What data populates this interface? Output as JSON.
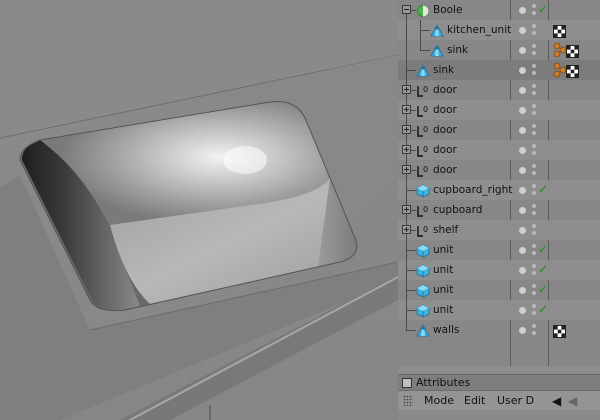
{
  "object_manager": {
    "rows": [
      {
        "name": "Boole",
        "level": 0,
        "expander": "minus",
        "icon": "boole-icon",
        "check": true,
        "tags": []
      },
      {
        "name": "kitchen_unit",
        "level": 1,
        "expander": "none",
        "icon": "cone-icon",
        "check": false,
        "tags": [
          "checker-tag-icon"
        ]
      },
      {
        "name": "sink",
        "level": 1,
        "expander": "none",
        "icon": "cone-icon",
        "check": false,
        "tags": [
          "phong-tag-icon",
          "checker-tag-icon"
        ]
      },
      {
        "name": "sink",
        "level": 0,
        "expander": "none",
        "icon": "cone-icon",
        "check": false,
        "tags": [
          "phong-tag-icon",
          "checker-tag-icon"
        ]
      },
      {
        "name": "door",
        "level": 0,
        "expander": "plus",
        "icon": "null-icon",
        "check": false,
        "tags": []
      },
      {
        "name": "door",
        "level": 0,
        "expander": "plus",
        "icon": "null-icon",
        "check": false,
        "tags": []
      },
      {
        "name": "door",
        "level": 0,
        "expander": "plus",
        "icon": "null-icon",
        "check": false,
        "tags": []
      },
      {
        "name": "door",
        "level": 0,
        "expander": "plus",
        "icon": "null-icon",
        "check": false,
        "tags": []
      },
      {
        "name": "door",
        "level": 0,
        "expander": "plus",
        "icon": "null-icon",
        "check": false,
        "tags": []
      },
      {
        "name": "cupboard_right",
        "level": 0,
        "expander": "none",
        "icon": "cube-icon",
        "check": true,
        "tags": []
      },
      {
        "name": "cupboard",
        "level": 0,
        "expander": "plus",
        "icon": "null-icon",
        "check": false,
        "tags": []
      },
      {
        "name": "shelf",
        "level": 0,
        "expander": "plus",
        "icon": "null-icon",
        "check": false,
        "tags": []
      },
      {
        "name": "unit",
        "level": 0,
        "expander": "none",
        "icon": "cube-icon",
        "check": true,
        "tags": []
      },
      {
        "name": "unit",
        "level": 0,
        "expander": "none",
        "icon": "cube-icon",
        "check": true,
        "tags": []
      },
      {
        "name": "unit",
        "level": 0,
        "expander": "none",
        "icon": "cube-icon",
        "check": true,
        "tags": []
      },
      {
        "name": "unit",
        "level": 0,
        "expander": "none",
        "icon": "cube-icon",
        "check": true,
        "tags": []
      },
      {
        "name": "walls",
        "level": 0,
        "expander": "none",
        "icon": "cone-icon",
        "check": false,
        "tags": [
          "checker-tag-icon"
        ]
      }
    ]
  },
  "attributes": {
    "title": "Attributes",
    "menus": [
      "Mode",
      "Edit",
      "User D"
    ],
    "nav_back_icon": "triangle-left-icon",
    "nav_forward_icon": "triangle-left-icon"
  },
  "colors": {
    "check": "#1f8a1f",
    "cube": "#3fb0e0",
    "boole_green": "#49b649"
  }
}
